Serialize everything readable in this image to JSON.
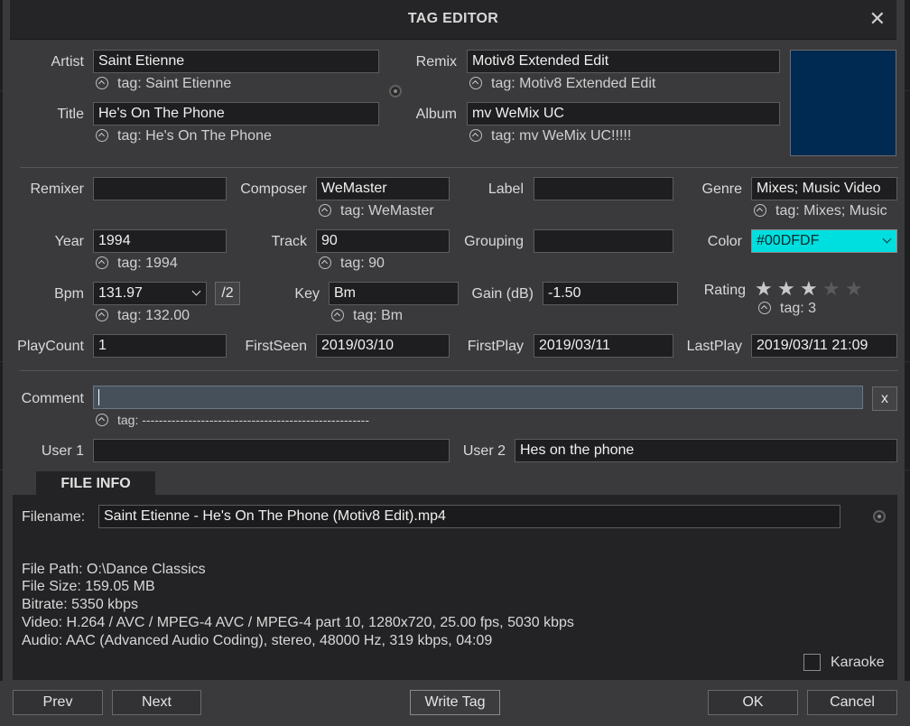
{
  "dialog": {
    "title": "TAG EDITOR",
    "close_glyph": "✕"
  },
  "fields": {
    "artist": {
      "label": "Artist",
      "value": "Saint Etienne",
      "tag": "tag: Saint Etienne"
    },
    "title": {
      "label": "Title",
      "value": "He's On The Phone",
      "tag": "tag: He's On The Phone"
    },
    "remix": {
      "label": "Remix",
      "value": "Motiv8 Extended Edit",
      "tag": "tag: Motiv8 Extended Edit"
    },
    "album": {
      "label": "Album",
      "value": "mv WeMix UC",
      "tag": "tag: mv WeMix UC!!!!!"
    },
    "remixer": {
      "label": "Remixer",
      "value": ""
    },
    "composer": {
      "label": "Composer",
      "value": "WeMaster",
      "tag": "tag: WeMaster"
    },
    "label": {
      "label": "Label",
      "value": ""
    },
    "genre": {
      "label": "Genre",
      "value": "Mixes; Music Video",
      "tag": "tag: Mixes; Music"
    },
    "year": {
      "label": "Year",
      "value": "1994",
      "tag": "tag: 1994"
    },
    "track": {
      "label": "Track",
      "value": "90",
      "tag": "tag: 90"
    },
    "grouping": {
      "label": "Grouping",
      "value": ""
    },
    "color": {
      "label": "Color",
      "value": "#00DFDF",
      "swatch": "#00dfdf"
    },
    "bpm": {
      "label": "Bpm",
      "value": "131.97",
      "half_button": "/2",
      "tag": "tag: 132.00"
    },
    "key": {
      "label": "Key",
      "value": "Bm",
      "tag": "tag: Bm"
    },
    "gain": {
      "label": "Gain (dB)",
      "value": "-1.50"
    },
    "rating": {
      "label": "Rating",
      "value": 3,
      "max": 5,
      "tag": "tag: 3"
    },
    "playcount": {
      "label": "PlayCount",
      "value": "1"
    },
    "firstseen": {
      "label": "FirstSeen",
      "value": "2019/03/10"
    },
    "firstplay": {
      "label": "FirstPlay",
      "value": "2019/03/11"
    },
    "lastplay": {
      "label": "LastPlay",
      "value": "2019/03/11 21:09"
    },
    "comment": {
      "label": "Comment",
      "value": "",
      "clear_label": "x",
      "tag": "tag: ------------------------------------------------------"
    },
    "user1": {
      "label": "User 1",
      "value": ""
    },
    "user2": {
      "label": "User 2",
      "value": "Hes on the phone"
    }
  },
  "cover_art": {
    "color": "#012a52"
  },
  "file_info": {
    "tab_label": "FILE INFO",
    "filename_label": "Filename:",
    "filename": "Saint Etienne - He's On The Phone (Motiv8 Edit).mp4",
    "lines": [
      "File Path: O:\\Dance Classics",
      "File Size: 159.05 MB",
      "Bitrate: 5350 kbps",
      "Video: H.264 / AVC / MPEG-4 AVC / MPEG-4 part 10, 1280x720, 25.00 fps, 5030 kbps",
      "Audio: AAC (Advanced Audio Coding), stereo, 48000 Hz, 319 kbps, 04:09"
    ],
    "karaoke_label": "Karaoke",
    "karaoke_checked": false
  },
  "buttons": {
    "prev": "Prev",
    "next": "Next",
    "write_tag": "Write Tag",
    "ok": "OK",
    "cancel": "Cancel"
  }
}
